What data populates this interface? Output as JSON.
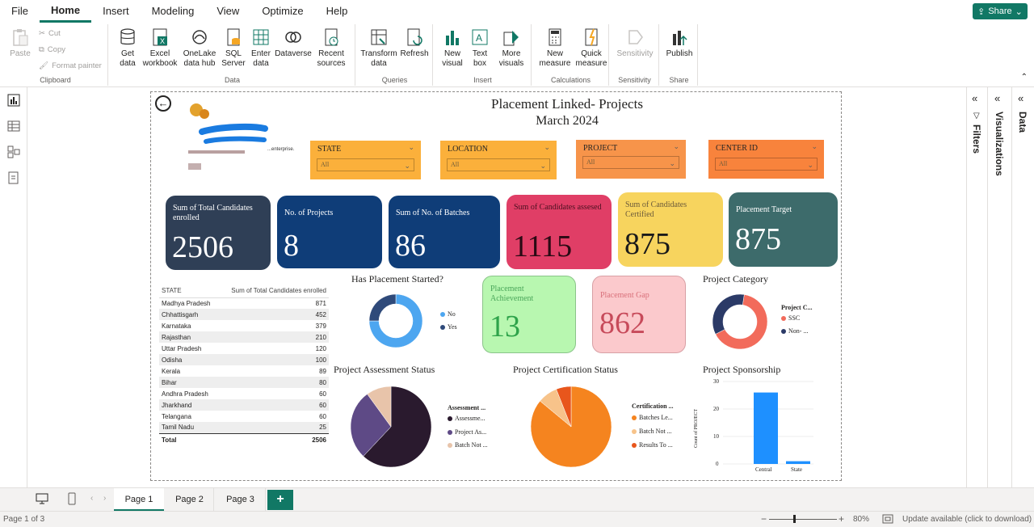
{
  "menu": {
    "items": [
      "File",
      "Home",
      "Insert",
      "Modeling",
      "View",
      "Optimize",
      "Help"
    ],
    "share_label": "Share"
  },
  "ribbon": {
    "clipboard": {
      "paste": "Paste",
      "cut": "Cut",
      "copy": "Copy",
      "format_painter": "Format painter",
      "label": "Clipboard"
    },
    "data": {
      "get_data": "Get data",
      "excel": "Excel workbook",
      "onelake": "OneLake data hub",
      "sql": "SQL Server",
      "enter": "Enter data",
      "dataverse": "Dataverse",
      "recent": "Recent sources",
      "label": "Data"
    },
    "queries": {
      "transform": "Transform data",
      "refresh": "Refresh",
      "label": "Queries"
    },
    "insert": {
      "new_visual": "New visual",
      "text_box": "Text box",
      "more_visuals": "More visuals",
      "label": "Insert"
    },
    "calculations": {
      "new_measure": "New measure",
      "quick_measure": "Quick measure",
      "label": "Calculations"
    },
    "sensitivity": {
      "sensitivity": "Sensitivity",
      "label": "Sensitivity"
    },
    "share": {
      "publish": "Publish",
      "label": "Share"
    }
  },
  "report": {
    "title": "Placement Linked- Projects",
    "subtitle": "March 2024",
    "logo_text": "...enterprise.",
    "slicers": [
      {
        "title": "STATE",
        "value": "All",
        "color": "#fbb03b"
      },
      {
        "title": "LOCATION",
        "value": "All",
        "color": "#fbb03b"
      },
      {
        "title": "PROJECT",
        "value": "All",
        "color": "#f7944a"
      },
      {
        "title": "CENTER ID",
        "value": "All",
        "color": "#f8833c"
      }
    ],
    "cards": [
      {
        "label": "Sum of Total Candidates enrolled",
        "value": "2506",
        "color": "#2f3f56"
      },
      {
        "label": "No. of Projects",
        "value": "8",
        "color": "#0f3d78"
      },
      {
        "label": "Sum of No. of Batches",
        "value": "86",
        "color": "#0f3d78"
      },
      {
        "label": "Sum of Candidates assesed",
        "value": "1115",
        "color": "#e03e66"
      },
      {
        "label": "Sum of Candidates Certified",
        "value": "875",
        "color": "#f7d45e"
      },
      {
        "label": "Placement Target",
        "value": "875",
        "color": "#3d6b6b"
      }
    ],
    "small_cards": [
      {
        "label": "Placement Achievement",
        "value": "13"
      },
      {
        "label": "Placement Gap",
        "value": "862"
      }
    ],
    "state_table": {
      "headers": [
        "STATE",
        "Sum of Total Candidates enrolled"
      ],
      "rows": [
        [
          "Madhya Pradesh",
          "871"
        ],
        [
          "Chhattisgarh",
          "452"
        ],
        [
          "Karnataka",
          "379"
        ],
        [
          "Rajasthan",
          "210"
        ],
        [
          "Uttar Pradesh",
          "120"
        ],
        [
          "Odisha",
          "100"
        ],
        [
          "Kerala",
          "89"
        ],
        [
          "Bihar",
          "80"
        ],
        [
          "Andhra Pradesh",
          "60"
        ],
        [
          "Jharkhand",
          "60"
        ],
        [
          "Telangana",
          "60"
        ],
        [
          "Tamil Nadu",
          "25"
        ]
      ],
      "total_label": "Total",
      "total_value": "2506"
    },
    "placement_started": {
      "title": "Has Placement Started?",
      "legend": [
        "No",
        "Yes"
      ]
    },
    "project_category": {
      "title": "Project Category",
      "legend_title": "Project C...",
      "legend": [
        "SSC",
        "Non- ..."
      ]
    },
    "assessment": {
      "title": "Project Assessment Status",
      "legend_title": "Assessment ...",
      "legend": [
        "Assessme...",
        "Project As...",
        "Batch Not ..."
      ]
    },
    "certification": {
      "title": "Project Certification Status",
      "legend_title": "Certification ...",
      "legend": [
        "Batches Le...",
        "Batch Not ...",
        "Results To ..."
      ]
    },
    "sponsorship": {
      "title": "Project Sponsorship",
      "ylabel": "Count of PROJECT",
      "yticks": [
        "30",
        "20",
        "10",
        "0"
      ]
    }
  },
  "chart_data": [
    {
      "type": "pie",
      "title": "Has Placement Started?",
      "categories": [
        "No",
        "Yes"
      ],
      "values": [
        75,
        25
      ],
      "colors": [
        "#4da6f0",
        "#2f4a7a"
      ]
    },
    {
      "type": "pie",
      "title": "Project Category",
      "categories": [
        "SSC",
        "Non- ..."
      ],
      "values": [
        65,
        35
      ],
      "colors": [
        "#f26b5b",
        "#2b3a67"
      ]
    },
    {
      "type": "pie",
      "title": "Project Assessment Status",
      "categories": [
        "Assessme...",
        "Project As...",
        "Batch Not ..."
      ],
      "values": [
        62,
        28,
        10
      ],
      "colors": [
        "#2a1a2e",
        "#5e4a86",
        "#e8c4aa"
      ]
    },
    {
      "type": "pie",
      "title": "Project Certification Status",
      "categories": [
        "Batches Le...",
        "Batch Not ...",
        "Results To ..."
      ],
      "values": [
        86,
        8,
        6
      ],
      "colors": [
        "#f5841f",
        "#f7c38a",
        "#e8561c"
      ]
    },
    {
      "type": "bar",
      "title": "Project Sponsorship",
      "categories": [
        "Central",
        "State"
      ],
      "values": [
        26,
        1
      ],
      "ylim": [
        0,
        30
      ],
      "ylabel": "Count of PROJECT",
      "color": "#1e90ff"
    }
  ],
  "pages": {
    "tabs": [
      "Page 1",
      "Page 2",
      "Page 3"
    ],
    "add": "+"
  },
  "status": {
    "page": "Page 1 of 3",
    "zoom": "80%",
    "update": "Update available (click to download)"
  },
  "panes": {
    "filters": "Filters",
    "visualizations": "Visualizations",
    "data": "Data"
  }
}
